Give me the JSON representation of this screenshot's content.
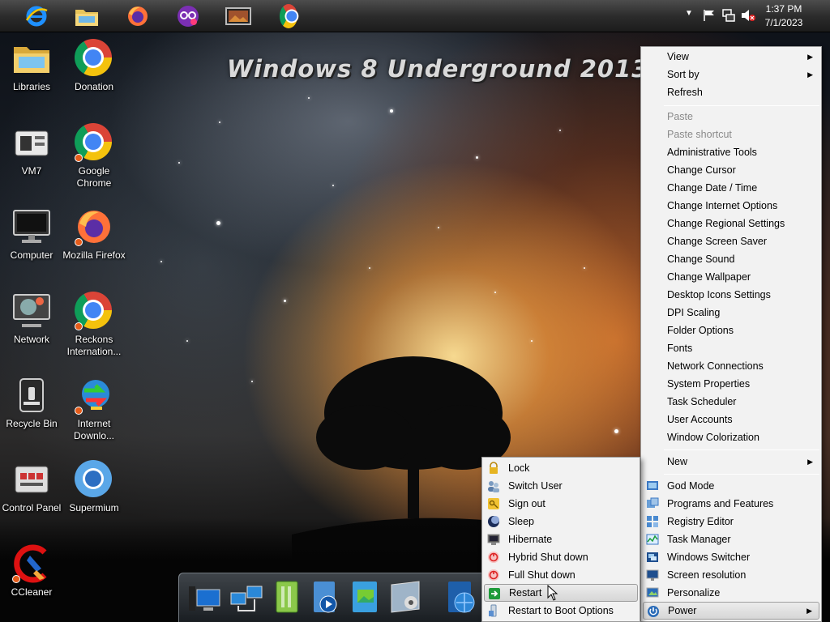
{
  "taskbar": {
    "apps": [
      {
        "name": "internet-explorer"
      },
      {
        "name": "file-explorer"
      },
      {
        "name": "firefox"
      },
      {
        "name": "private-browser"
      },
      {
        "name": "photo-viewer"
      },
      {
        "name": "chrome"
      }
    ],
    "clock": {
      "time": "1:37 PM",
      "date": "7/1/2023"
    }
  },
  "wallpaper": {
    "title": "Windows 8 Underground 2013"
  },
  "desktop_icons": [
    {
      "label": "Libraries"
    },
    {
      "label": "Donation"
    },
    {
      "label": "VM7"
    },
    {
      "label": "Google Chrome"
    },
    {
      "label": "Computer"
    },
    {
      "label": "Mozilla Firefox"
    },
    {
      "label": "Network"
    },
    {
      "label": "Reckons Internation..."
    },
    {
      "label": "Recycle Bin"
    },
    {
      "label": "Internet Downlo..."
    },
    {
      "label": "Control Panel"
    },
    {
      "label": "Supermium"
    },
    {
      "label": "CCleaner"
    }
  ],
  "context_menu": {
    "view": "View",
    "sort_by": "Sort by",
    "refresh": "Refresh",
    "paste": "Paste",
    "paste_shortcut": "Paste shortcut",
    "tools": [
      "Administrative Tools",
      "Change Cursor",
      "Change Date / Time",
      "Change Internet Options",
      "Change Regional Settings",
      "Change Screen Saver",
      "Change Sound",
      "Change Wallpaper",
      "Desktop Icons Settings",
      "DPI Scaling",
      "Folder Options",
      "Fonts",
      "Network Connections",
      "System Properties",
      "Task Scheduler",
      "User Accounts",
      "Window Colorization"
    ],
    "new": "New",
    "extras": [
      "God Mode",
      "Programs and Features",
      "Registry Editor",
      "Task Manager",
      "Windows Switcher",
      "Screen resolution",
      "Personalize"
    ],
    "power": "Power"
  },
  "power_menu": {
    "items": [
      "Lock",
      "Switch User",
      "Sign out",
      "Sleep",
      "Hibernate",
      "Hybrid Shut down",
      "Full Shut down",
      "Restart",
      "Restart to Boot Options"
    ],
    "highlighted": "Restart"
  },
  "colors": {
    "menu_bg": "#f2f2f2",
    "highlight": "#d6d6d6",
    "taskbar": "#2c2c2c"
  }
}
